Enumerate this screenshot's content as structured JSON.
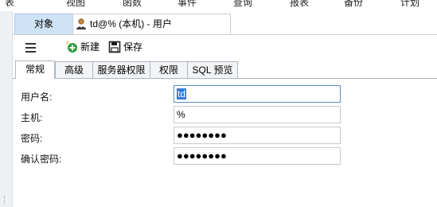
{
  "menu": [
    "表",
    "视图",
    "函数",
    "事件",
    "查询",
    "报表",
    "备份",
    "计划"
  ],
  "doc_tabs": {
    "objects_label": "对象",
    "user_tab_title": "td@% (本机) - 用户"
  },
  "toolbar": {
    "new_label": "新建",
    "save_label": "保存"
  },
  "sub_tabs": [
    {
      "label": "常规",
      "active": true
    },
    {
      "label": "高级",
      "active": false
    },
    {
      "label": "服务器权限",
      "active": false
    },
    {
      "label": "权限",
      "active": false
    },
    {
      "label": "SQL 预览",
      "active": false
    }
  ],
  "form": {
    "username_label": "用户名:",
    "username_value": "td",
    "host_label": "主机:",
    "host_value": "%",
    "password_label": "密码:",
    "password_value": "●●●●●●●●",
    "confirm_label": "确认密码:",
    "confirm_value": "●●●●●●●●"
  },
  "colors": {
    "objects_tab_bg": "#cfe3f7",
    "selection": "#3b78d4",
    "new_icon_green": "#2e9e3a"
  },
  "icons": [
    "hamburger-menu-icon",
    "user-icon",
    "new-plus-icon",
    "save-disk-icon"
  ]
}
